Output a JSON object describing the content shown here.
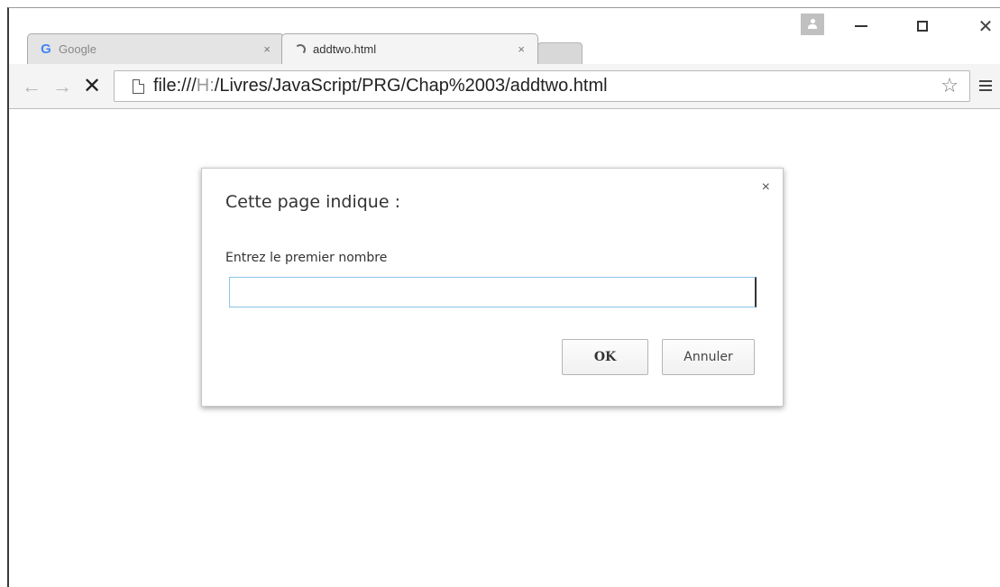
{
  "tabs": [
    {
      "title": "Google",
      "close": "×",
      "favicon": "google-g-icon",
      "active": false
    },
    {
      "title": "addtwo.html",
      "close": "×",
      "favicon": "loading-spinner-icon",
      "active": true
    }
  ],
  "window_controls": {
    "minimize": "minimize-icon",
    "maximize": "maximize-icon",
    "close_glyph": "✕"
  },
  "toolbar": {
    "back_glyph": "←",
    "forward_glyph": "→",
    "stop_glyph": "✕",
    "url_prefix": "file:///",
    "url_host": "H:",
    "url_path": "/Livres/JavaScript/PRG/Chap%2003/addtwo.html",
    "bookmark_glyph": "☆"
  },
  "dialog": {
    "title": "Cette page indique :",
    "close_glyph": "×",
    "message": "Entrez le premier nombre",
    "input_value": "",
    "ok_label": "OK",
    "cancel_label": "Annuler"
  },
  "colors": {
    "google_blue": "#4285f4",
    "input_focus": "#8ac5e6"
  }
}
